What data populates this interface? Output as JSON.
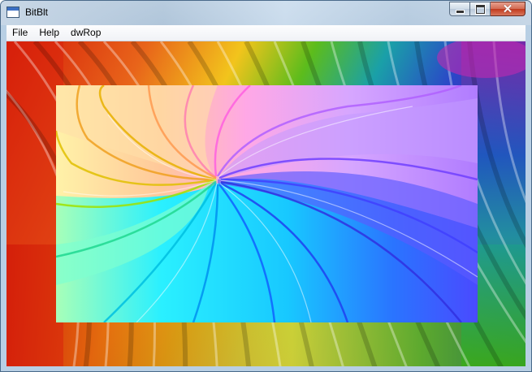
{
  "window": {
    "title": "BitBlt",
    "icon": "app-window-icon",
    "caption_buttons": [
      "minimize",
      "maximize",
      "close"
    ]
  },
  "menubar": {
    "items": [
      {
        "label": "File"
      },
      {
        "label": "Help"
      },
      {
        "label": "dwRop"
      }
    ]
  },
  "client": {
    "background_image": "rainbow-spiral-wallpaper",
    "blitted_image": "pastel-rainbow-swirl"
  },
  "colors": {
    "title_bar": "#b8cfe4",
    "close_button": "#c1391d",
    "menubar": "#f0f2f6"
  }
}
